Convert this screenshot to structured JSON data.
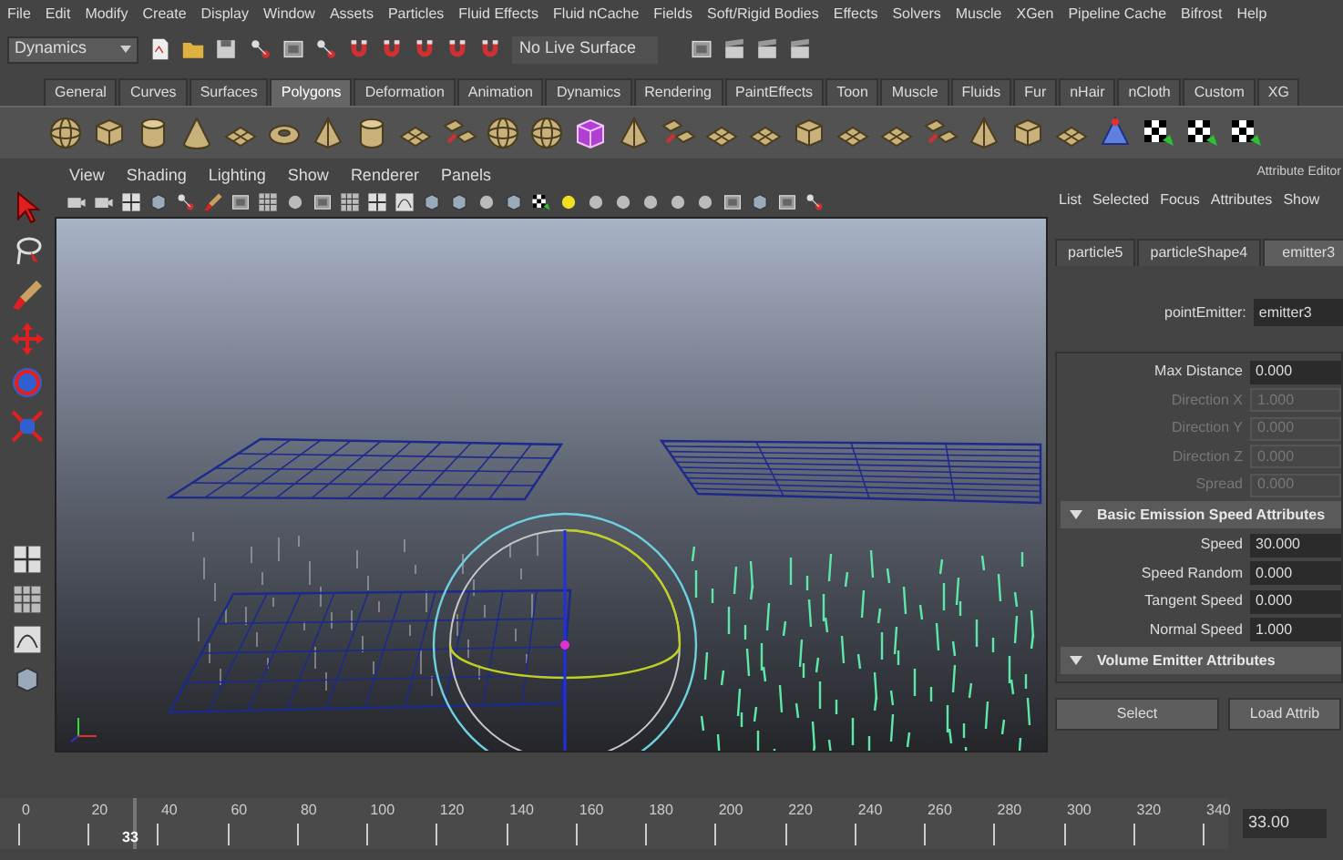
{
  "menu_bar": [
    "File",
    "Edit",
    "Modify",
    "Create",
    "Display",
    "Window",
    "Assets",
    "Particles",
    "Fluid Effects",
    "Fluid nCache",
    "Fields",
    "Soft/Rigid Bodies",
    "Effects",
    "Solvers",
    "Muscle",
    "XGen",
    "Pipeline Cache",
    "Bifrost",
    "Help"
  ],
  "status_line": {
    "menu_set": "Dynamics",
    "live_surface": "No Live Surface"
  },
  "shelf_tabs": [
    {
      "label": "General",
      "selected": false
    },
    {
      "label": "Curves",
      "selected": false
    },
    {
      "label": "Surfaces",
      "selected": false
    },
    {
      "label": "Polygons",
      "selected": true
    },
    {
      "label": "Deformation",
      "selected": false
    },
    {
      "label": "Animation",
      "selected": false
    },
    {
      "label": "Dynamics",
      "selected": false
    },
    {
      "label": "Rendering",
      "selected": false
    },
    {
      "label": "PaintEffects",
      "selected": false
    },
    {
      "label": "Toon",
      "selected": false
    },
    {
      "label": "Muscle",
      "selected": false
    },
    {
      "label": "Fluids",
      "selected": false
    },
    {
      "label": "Fur",
      "selected": false
    },
    {
      "label": "nHair",
      "selected": false
    },
    {
      "label": "nCloth",
      "selected": false
    },
    {
      "label": "Custom",
      "selected": false
    },
    {
      "label": "XG",
      "selected": false
    }
  ],
  "viewport": {
    "menu": [
      "View",
      "Shading",
      "Lighting",
      "Show",
      "Renderer",
      "Panels"
    ]
  },
  "attribute_editor": {
    "title": "Attribute Editor",
    "menu": [
      "List",
      "Selected",
      "Focus",
      "Attributes",
      "Show"
    ],
    "tabs": [
      {
        "label": "particle5",
        "selected": false
      },
      {
        "label": "particleShape4",
        "selected": false
      },
      {
        "label": "emitter3",
        "selected": true
      }
    ],
    "node_label": "pointEmitter:",
    "node_name": "emitter3",
    "rows": [
      {
        "kind": "field",
        "label": "Max Distance",
        "value": "0.000",
        "disabled": false
      },
      {
        "kind": "field",
        "label": "Direction X",
        "value": "1.000",
        "disabled": true
      },
      {
        "kind": "field",
        "label": "Direction Y",
        "value": "0.000",
        "disabled": true
      },
      {
        "kind": "field",
        "label": "Direction Z",
        "value": "0.000",
        "disabled": true
      },
      {
        "kind": "field",
        "label": "Spread",
        "value": "0.000",
        "disabled": true
      },
      {
        "kind": "section",
        "label": "Basic Emission Speed Attributes",
        "expanded": true
      },
      {
        "kind": "field",
        "label": "Speed",
        "value": "30.000",
        "disabled": false
      },
      {
        "kind": "field",
        "label": "Speed Random",
        "value": "0.000",
        "disabled": false
      },
      {
        "kind": "field",
        "label": "Tangent Speed",
        "value": "0.000",
        "disabled": false
      },
      {
        "kind": "field",
        "label": "Normal Speed",
        "value": "1.000",
        "disabled": false
      },
      {
        "kind": "section",
        "label": "Volume Emitter Attributes",
        "expanded": true
      }
    ],
    "buttons": [
      "Select",
      "Load Attrib"
    ]
  },
  "time_slider": {
    "ticks": [
      "0",
      "20",
      "40",
      "60",
      "80",
      "100",
      "120",
      "140",
      "160",
      "180",
      "200",
      "220",
      "240",
      "260",
      "280",
      "300",
      "320",
      "340"
    ],
    "playhead": {
      "level": 0.097
    },
    "current": "33",
    "current_field": "33.00"
  }
}
